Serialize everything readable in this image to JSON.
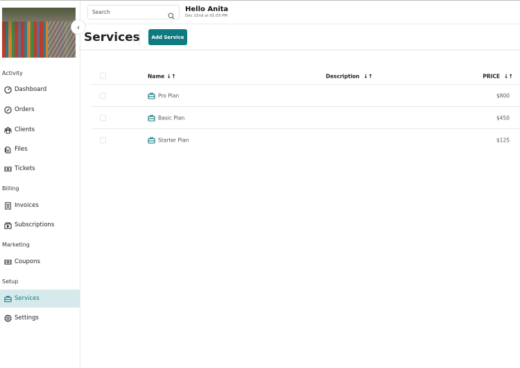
{
  "header": {
    "search_placeholder": "Search",
    "greeting": "Hello Anita",
    "datetime": "Dec 22nd at 01:03 PM"
  },
  "sidebar": {
    "sections": [
      {
        "label": "Activity"
      },
      {
        "label": "Billing"
      },
      {
        "label": "Marketing"
      },
      {
        "label": "Setup"
      }
    ],
    "items": [
      {
        "label": "Dashboard",
        "icon": "dashboard-icon"
      },
      {
        "label": "Orders",
        "icon": "orders-icon"
      },
      {
        "label": "Clients",
        "icon": "clients-icon"
      },
      {
        "label": "Files",
        "icon": "files-icon"
      },
      {
        "label": "Tickets",
        "icon": "tickets-icon"
      },
      {
        "label": "Invoices",
        "icon": "invoices-icon"
      },
      {
        "label": "Subscriptions",
        "icon": "subscriptions-icon"
      },
      {
        "label": "Coupons",
        "icon": "coupons-icon"
      },
      {
        "label": "Services",
        "icon": "briefcase-icon",
        "active": true
      },
      {
        "label": "Settings",
        "icon": "gear-icon"
      }
    ]
  },
  "page": {
    "title": "Services",
    "add_button": "Add Service"
  },
  "table": {
    "columns": [
      {
        "label": "Name",
        "sort": "↓↑"
      },
      {
        "label": "Description",
        "sort": "↓↑"
      },
      {
        "label": "PRICE",
        "sort": "↓↑"
      }
    ],
    "rows": [
      {
        "name": "Pro Plan",
        "description": "",
        "price": "$800"
      },
      {
        "name": "Basic Plan",
        "description": "",
        "price": "$450"
      },
      {
        "name": "Starter Plan",
        "description": "",
        "price": "$125"
      }
    ]
  },
  "colors": {
    "accent": "#0f7b80",
    "active_bg": "#d6eaec"
  }
}
